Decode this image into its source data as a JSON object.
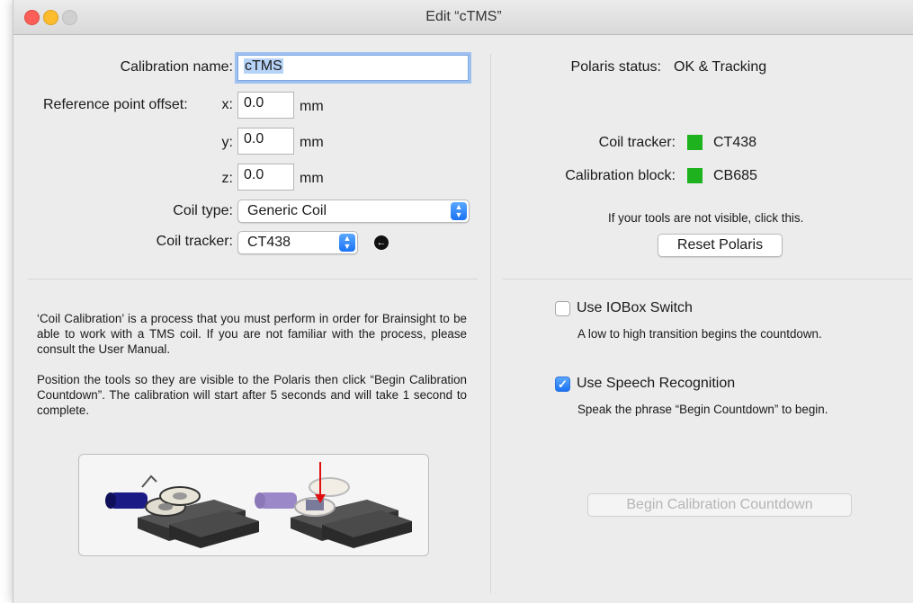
{
  "window": {
    "title": "Edit “cTMS”"
  },
  "form": {
    "calibration_name_label": "Calibration name:",
    "calibration_name_value": "cTMS",
    "offset_label": "Reference point offset:",
    "x_label": "x:",
    "x_value": "0.0",
    "y_label": "y:",
    "y_value": "0.0",
    "z_label": "z:",
    "z_value": "0.0",
    "unit": "mm",
    "coil_type_label": "Coil type:",
    "coil_type_value": "Generic Coil",
    "coil_tracker_label": "Coil tracker:",
    "coil_tracker_value": "CT438"
  },
  "info": {
    "para1": "‘Coil Calibration’ is a process that you must perform in order for Brainsight to be able to work with a TMS coil. If you are not familiar with the process, please consult the User Manual.",
    "para2": "Position the tools so they are visible to the Polaris then click “Begin Calibration Countdown”. The calibration will start after 5 seconds and will take 1 second to complete."
  },
  "status": {
    "polaris_label": "Polaris status:",
    "polaris_value": "OK & Tracking",
    "coil_tracker_label": "Coil tracker:",
    "coil_tracker_value": "CT438",
    "calibration_block_label": "Calibration block:",
    "calibration_block_value": "CB685",
    "tracked_color": "#1fb21f",
    "hint": "If your tools are not visible, click this.",
    "reset_button": "Reset Polaris"
  },
  "options": {
    "iobox_label": "Use IOBox Switch",
    "iobox_checked": false,
    "iobox_desc": "A low to high transition begins the countdown.",
    "speech_label": "Use Speech Recognition",
    "speech_checked": true,
    "speech_desc": "Speak the phrase “Begin Countdown” to begin."
  },
  "actions": {
    "begin_button": "Begin Calibration Countdown"
  }
}
